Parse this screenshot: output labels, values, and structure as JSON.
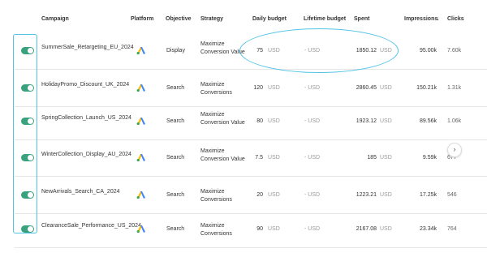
{
  "header": {
    "campaign": "Campaign",
    "platform": "Platform",
    "objective": "Objective",
    "strategy": "Strategy",
    "daily_budget": "Daily budget",
    "lifetime_budget": "Lifetime budget",
    "spent": "Spent",
    "impressions": "Impressions",
    "sort_icon": "↓",
    "clicks": "Clicks"
  },
  "currency": "USD",
  "lifetime_value": "- USD",
  "accent_color": "#3aa17e",
  "highlight_color": "#52c3e6",
  "rows": [
    {
      "name": "SummerSale_Retargeting_EU_2024",
      "objective": "Display",
      "strategy": "Maximize Conversion Value",
      "daily": "75",
      "spent": "1850.12",
      "impressions": "95.00k",
      "clicks": "7.60k"
    },
    {
      "name": "HolidayPromo_Discount_UK_2024",
      "objective": "Search",
      "strategy": "Maximize Conversions",
      "daily": "120",
      "spent": "2860.45",
      "impressions": "150.21k",
      "clicks": "1.31k"
    },
    {
      "name": "SpringCollection_Launch_US_2024",
      "objective": "Search",
      "strategy": "Maximize Conversion Value",
      "daily": "80",
      "spent": "1923.12",
      "impressions": "89.56k",
      "clicks": "1.06k"
    },
    {
      "name": "WinterCollection_Display_AU_2024",
      "objective": "Search",
      "strategy": "Maximize Conversion Value",
      "daily": "7.5",
      "spent": "185",
      "impressions": "9.59k",
      "clicks": "677"
    },
    {
      "name": "NewArrivals_Search_CA_2024",
      "objective": "Search",
      "strategy": "Maximize Conversions",
      "daily": "20",
      "spent": "1223.21",
      "impressions": "17.25k",
      "clicks": "546"
    },
    {
      "name": "ClearanceSale_Performance_US_2024",
      "objective": "Search",
      "strategy": "Maximize Conversions",
      "daily": "90",
      "spent": "2167.08",
      "impressions": "23.34k",
      "clicks": "764"
    }
  ],
  "scroll_button": "›"
}
